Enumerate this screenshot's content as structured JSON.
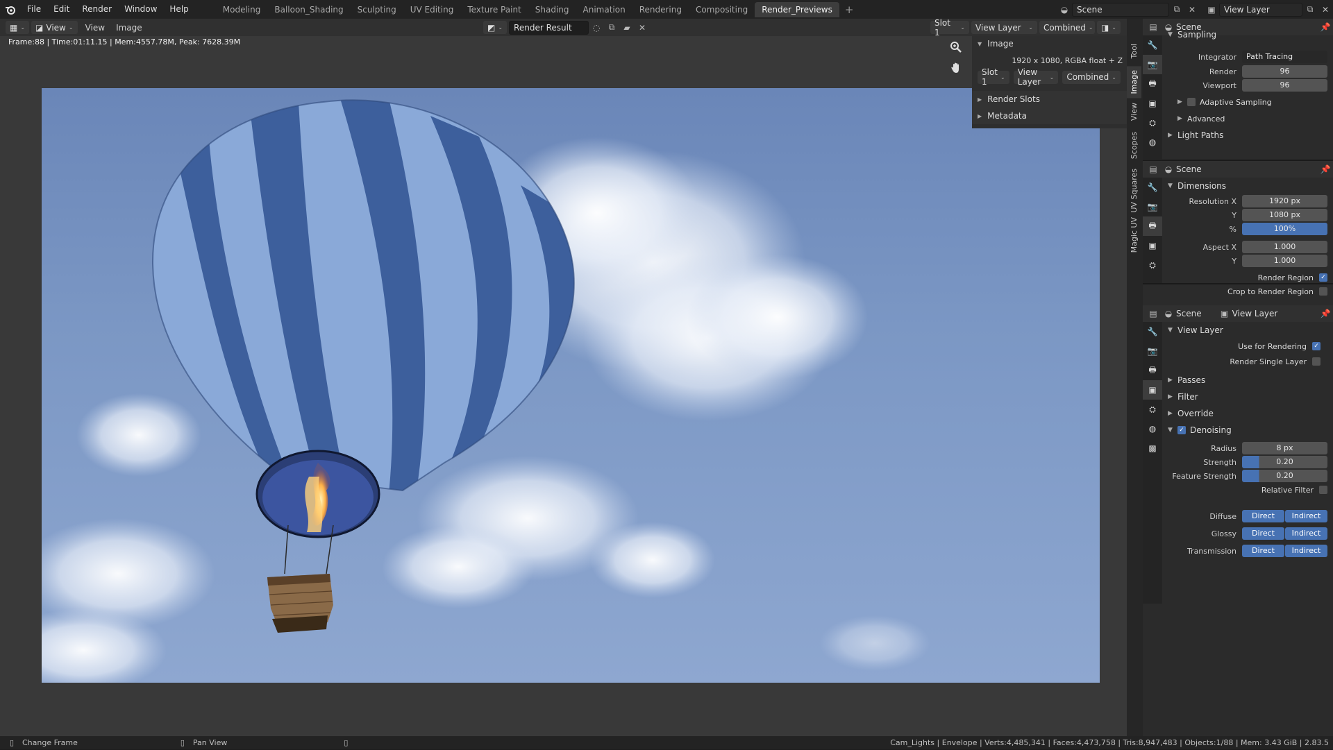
{
  "menu": {
    "file": "File",
    "edit": "Edit",
    "render": "Render",
    "window": "Window",
    "help": "Help"
  },
  "workspaces": [
    "Modeling",
    "Balloon_Shading",
    "Sculpting",
    "UV Editing",
    "Texture Paint",
    "Shading",
    "Animation",
    "Rendering",
    "Compositing",
    "Render_Previews"
  ],
  "workspace_add": "+",
  "scene_field": "Scene",
  "viewlayer_field": "View Layer",
  "editor_header": {
    "view_menu": "View",
    "view2": "View",
    "image_menu": "Image",
    "image_name": "Render Result",
    "slot": "Slot 1",
    "view_layer": "View Layer",
    "pass": "Combined"
  },
  "frame_info": "Frame:88 | Time:01:11.15 | Mem:4557.78M, Peak: 7628.39M",
  "npanel": {
    "image_label": "Image",
    "resolution": "1920 x 1080,  RGBA float + Z",
    "slot": "Slot 1",
    "view_layer": "View Layer",
    "pass": "Combined",
    "render_slots": "Render Slots",
    "metadata": "Metadata"
  },
  "vtabs": [
    "Tool",
    "Image",
    "View",
    "Scopes",
    "UV Squares",
    "Magic UV"
  ],
  "sampling_panel": {
    "scene": "Scene",
    "section": "Sampling",
    "integrator_label": "Integrator",
    "integrator": "Path Tracing",
    "render_label": "Render",
    "render": "96",
    "viewport_label": "Viewport",
    "viewport": "96",
    "adaptive": "Adaptive Sampling",
    "advanced": "Advanced",
    "light_paths": "Light Paths"
  },
  "dimensions_panel": {
    "scene": "Scene",
    "section": "Dimensions",
    "resx_label": "Resolution X",
    "resx": "1920 px",
    "resy_label": "Y",
    "resy": "1080 px",
    "pct_label": "%",
    "pct": "100%",
    "aspx_label": "Aspect X",
    "aspx": "1.000",
    "aspy_label": "Y",
    "aspy": "1.000",
    "render_region": "Render Region",
    "crop_region": "Crop to Render Region"
  },
  "viewlayer_panel": {
    "scene": "Scene",
    "view_layer": "View Layer",
    "section": "View Layer",
    "use_for_rendering": "Use for Rendering",
    "render_single": "Render Single Layer",
    "passes": "Passes",
    "filter": "Filter",
    "override": "Override",
    "denoising": "Denoising",
    "radius_label": "Radius",
    "radius": "8 px",
    "strength_label": "Strength",
    "strength": "0.20",
    "feature_label": "Feature Strength",
    "feature": "0.20",
    "relative": "Relative Filter",
    "diffuse": "Diffuse",
    "glossy": "Glossy",
    "transmission": "Transmission",
    "direct": "Direct",
    "indirect": "Indirect"
  },
  "status": {
    "change_frame": "Change Frame",
    "pan_view": "Pan View",
    "right": "Cam_Lights | Envelope | Verts:4,485,341 | Faces:4,473,758 | Tris:8,947,483 | Objects:1/88 | Mem: 3.43 GiB | 2.83.5"
  },
  "colors": {
    "accent": "#4772b3",
    "sky": "#7b97c4",
    "balloon_dark": "#3d5f9c",
    "balloon_light": "#8aa9d8"
  }
}
